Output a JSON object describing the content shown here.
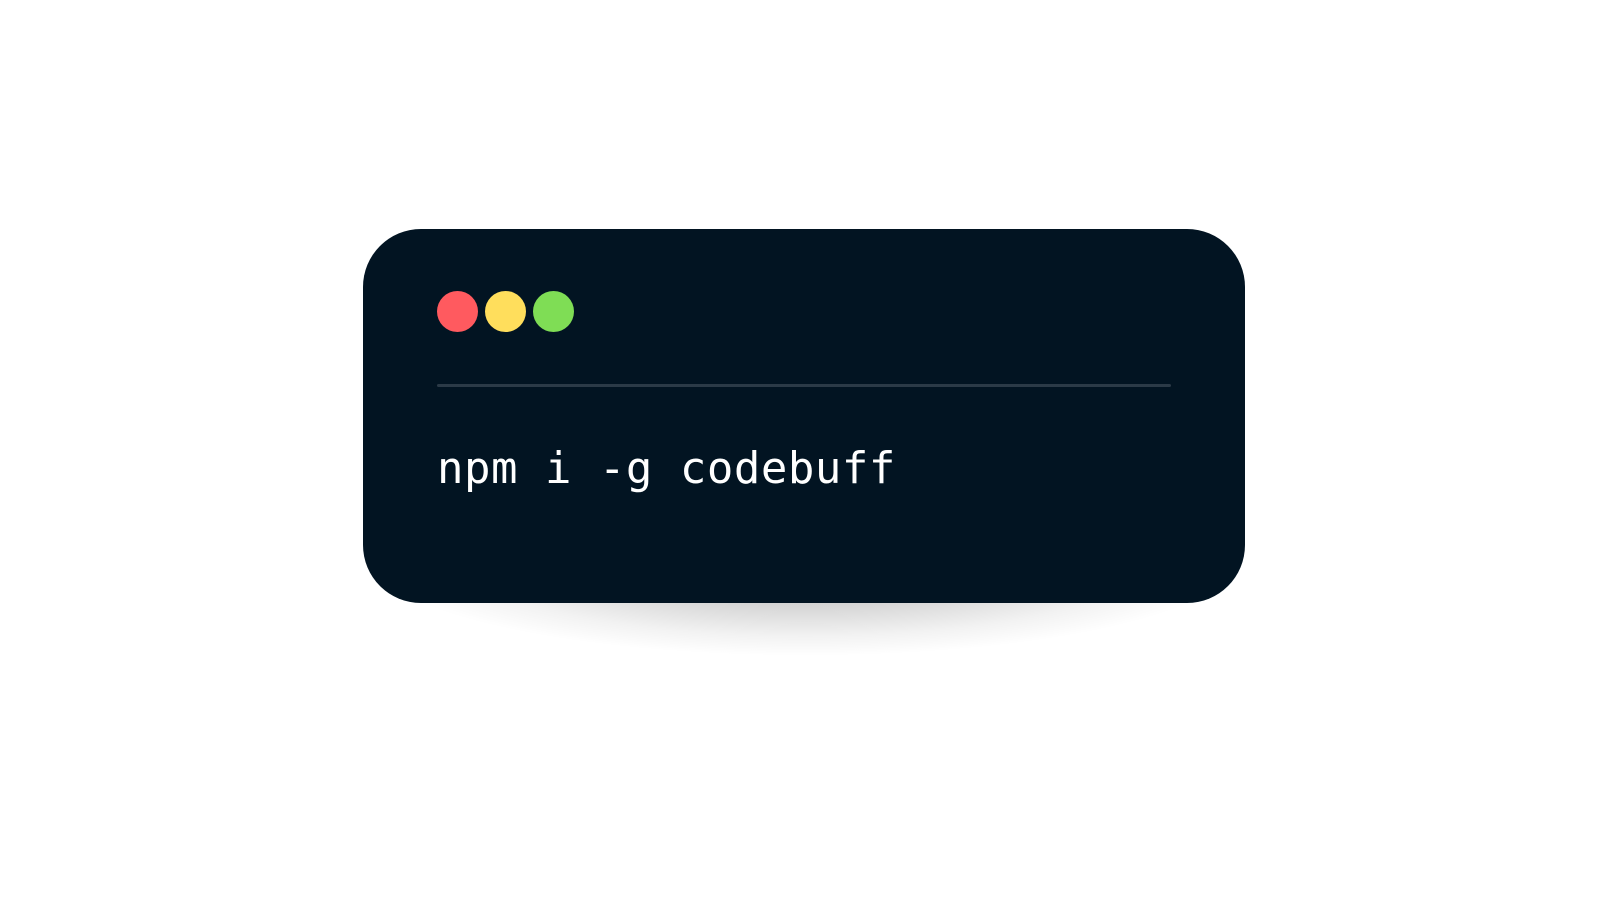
{
  "terminal": {
    "background_color": "#021422",
    "divider_color": "#2b3a47",
    "traffic_lights": [
      {
        "name": "close-light",
        "icon": "red-dot",
        "color": "#FF5A5F"
      },
      {
        "name": "minimize-light",
        "icon": "yellow-dot",
        "color": "#FFDE5C"
      },
      {
        "name": "maximize-light",
        "icon": "green-dot",
        "color": "#7FDD55"
      }
    ],
    "command": "npm i -g codebuff",
    "command_color": "#ffffff"
  }
}
